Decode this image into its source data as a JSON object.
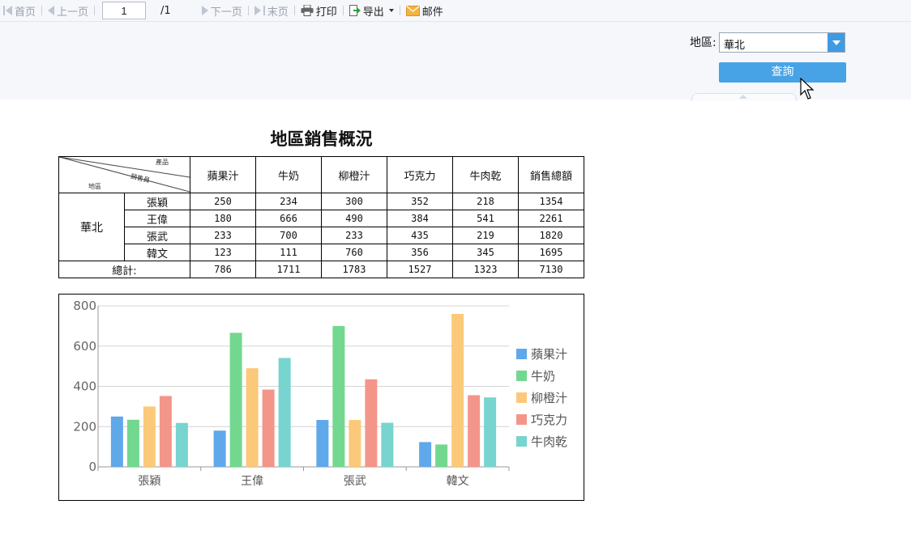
{
  "toolbar": {
    "first": "首页",
    "prev": "上一页",
    "page_value": "1",
    "page_total": "/1",
    "next": "下一页",
    "last": "末页",
    "print": "打印",
    "export": "导出",
    "mail": "邮件"
  },
  "params": {
    "region_label": "地區:",
    "region_value": "華北",
    "query_label": "查詢"
  },
  "report": {
    "title": "地區銷售概況",
    "header_diag": {
      "top": "產品",
      "middle": "銷售員",
      "bottom": "地區"
    },
    "columns": [
      "蘋果汁",
      "牛奶",
      "柳橙汁",
      "巧克力",
      "牛肉乾",
      "銷售總額"
    ],
    "region": "華北",
    "rows": [
      {
        "name": "張穎",
        "values": [
          "250",
          "234",
          "300",
          "352",
          "218",
          "1354"
        ]
      },
      {
        "name": "王偉",
        "values": [
          "180",
          "666",
          "490",
          "384",
          "541",
          "2261"
        ]
      },
      {
        "name": "張武",
        "values": [
          "233",
          "700",
          "233",
          "435",
          "219",
          "1820"
        ]
      },
      {
        "name": "韓文",
        "values": [
          "123",
          "111",
          "760",
          "356",
          "345",
          "1695"
        ]
      }
    ],
    "total_label": "總計:",
    "totals": [
      "786",
      "1711",
      "1783",
      "1527",
      "1323",
      "7130"
    ]
  },
  "chart_data": {
    "type": "bar",
    "categories": [
      "張穎",
      "王偉",
      "張武",
      "韓文"
    ],
    "series": [
      {
        "name": "蘋果汁",
        "values": [
          250,
          180,
          233,
          123
        ],
        "color": "#5fa8ea"
      },
      {
        "name": "牛奶",
        "values": [
          234,
          666,
          700,
          111
        ],
        "color": "#73d88f"
      },
      {
        "name": "柳橙汁",
        "values": [
          300,
          490,
          233,
          760
        ],
        "color": "#fbc979"
      },
      {
        "name": "巧克力",
        "values": [
          352,
          384,
          435,
          356
        ],
        "color": "#f4958a"
      },
      {
        "name": "牛肉乾",
        "values": [
          218,
          541,
          219,
          345
        ],
        "color": "#77d4cf"
      }
    ],
    "yticks": [
      0,
      200,
      400,
      600,
      800
    ],
    "ylim": [
      0,
      800
    ],
    "grid": true,
    "legend": "right"
  }
}
